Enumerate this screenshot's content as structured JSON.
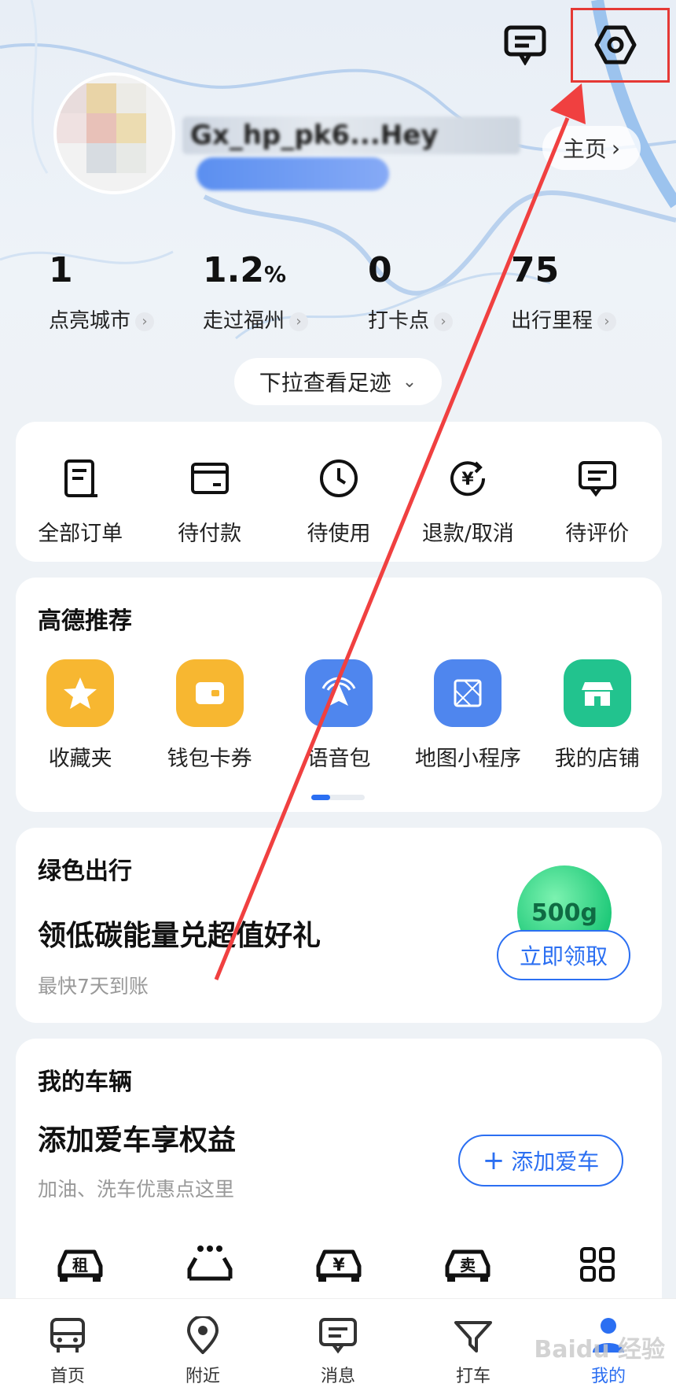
{
  "header": {
    "username": "Gx_hp_pk6...Hey",
    "homepage_label": "主页",
    "message_icon": "message-square-icon",
    "settings_icon": "settings-hexagon-icon"
  },
  "stats": [
    {
      "value": "1",
      "unit": "",
      "label": "点亮城市"
    },
    {
      "value": "1.2",
      "unit": "%",
      "label": "走过福州"
    },
    {
      "value": "0",
      "unit": "",
      "label": "打卡点"
    },
    {
      "value": "75",
      "unit": "",
      "label": "出行里程"
    }
  ],
  "pulldown_label": "下拉查看足迹",
  "orders": [
    {
      "label": "全部订单",
      "icon": "order-list-icon"
    },
    {
      "label": "待付款",
      "icon": "card-icon"
    },
    {
      "label": "待使用",
      "icon": "clock-icon"
    },
    {
      "label": "退款/取消",
      "icon": "refund-icon"
    },
    {
      "label": "待评价",
      "icon": "comment-icon"
    }
  ],
  "recommend": {
    "title": "高德推荐",
    "items": [
      {
        "label": "收藏夹",
        "icon": "star-icon",
        "color": "#f7b731"
      },
      {
        "label": "钱包卡券",
        "icon": "wallet-icon",
        "color": "#f7b731"
      },
      {
        "label": "语音包",
        "icon": "voice-nav-icon",
        "color": "#4f86ee"
      },
      {
        "label": "地图小程序",
        "icon": "mini-program-icon",
        "color": "#4f86ee"
      },
      {
        "label": "我的店铺",
        "icon": "shop-icon",
        "color": "#22c38e"
      }
    ]
  },
  "green": {
    "title": "绿色出行",
    "headline": "领低碳能量兑超值好礼",
    "sub": "最快7天到账",
    "energy": "500g",
    "button": "立即领取"
  },
  "vehicle": {
    "title": "我的车辆",
    "headline": "添加爱车享权益",
    "sub": "加油、洗车优惠点这里",
    "button": "添加爱车",
    "services": [
      {
        "icon": "rent-car-icon",
        "glyph": "租"
      },
      {
        "icon": "car-wash-icon",
        "glyph": ""
      },
      {
        "icon": "car-loan-icon",
        "glyph": "¥"
      },
      {
        "icon": "sell-car-icon",
        "glyph": "卖"
      },
      {
        "icon": "grid-more-icon",
        "glyph": ""
      }
    ]
  },
  "tabs": [
    {
      "label": "首页",
      "icon": "bus-icon"
    },
    {
      "label": "附近",
      "icon": "location-pin-icon"
    },
    {
      "label": "消息",
      "icon": "message-icon"
    },
    {
      "label": "打车",
      "icon": "taxi-icon"
    },
    {
      "label": "我的",
      "icon": "profile-icon",
      "active": true
    }
  ],
  "watermark": "Baidu 经验",
  "colors": {
    "accent": "#2b6ff2",
    "annotation": "#e53935"
  }
}
